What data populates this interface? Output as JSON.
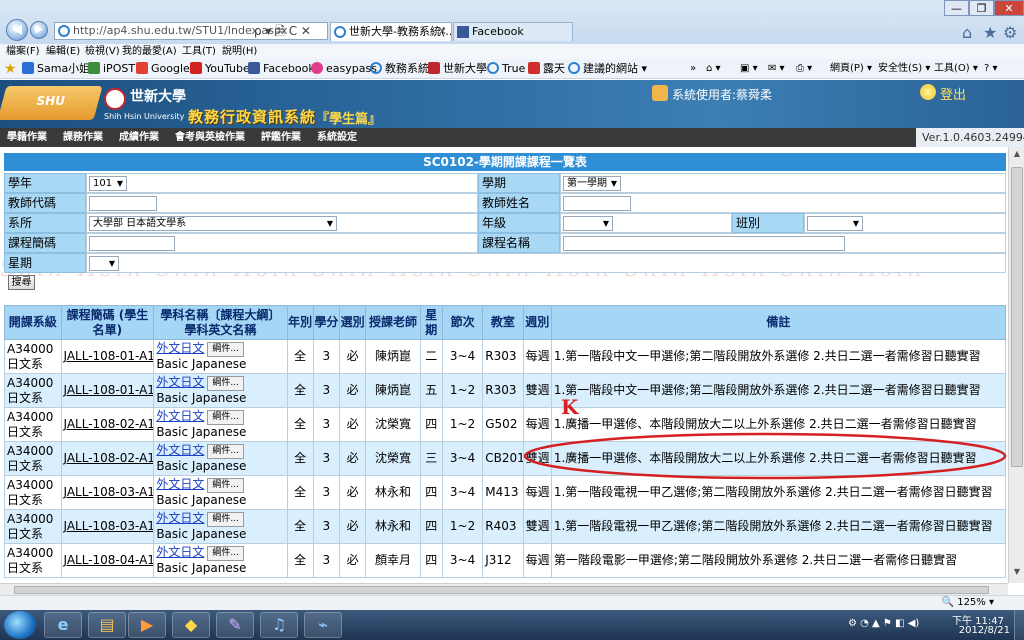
{
  "browser": {
    "url": "http://ap4.shu.edu.tw/STU1/Index.aspx",
    "address_icons": "ρ ▾ 🗎 C ✕",
    "tabs": [
      {
        "label": "世新大學-教務系統(...",
        "close": "✕"
      },
      {
        "label": "Facebook"
      }
    ],
    "window_buttons": {
      "minimize": "—",
      "maximize": "❐",
      "close": "✕"
    },
    "right_icons": {
      "home": "⌂",
      "star": "★",
      "gear": "⚙"
    },
    "menu": [
      "檔案(F)",
      "編輯(E)",
      "檢視(V)",
      "我的最愛(A)",
      "工具(T)",
      "說明(H)"
    ],
    "favorites": [
      {
        "label": "Sama小姐",
        "color": "#2c6ed5"
      },
      {
        "label": "iPOST",
        "color": "#3e8e3e"
      },
      {
        "label": "Google",
        "color": "#e34133"
      },
      {
        "label": "YouTube",
        "color": "#d32020"
      },
      {
        "label": "Facebook",
        "color": "#3b5998"
      },
      {
        "label": "easypass",
        "color": "#e03c8b"
      },
      {
        "label": "教務系統",
        "color": "#2f7fd1"
      },
      {
        "label": "世新大學",
        "color": "#c0282f"
      },
      {
        "label": "True",
        "color": "#2f7fd1"
      },
      {
        "label": "露天",
        "color": "#d12f2f"
      },
      {
        "label": "建議的網站 ▾",
        "color": "#2f7fd1"
      }
    ],
    "commands": {
      "more": "»",
      "home": "⌂ ▾",
      "rss": "▣ ▾",
      "mail": "✉ ▾",
      "print": "⎙ ▾",
      "page": "網頁(P) ▾",
      "safety": "安全性(S) ▾",
      "tools": "工具(O) ▾",
      "help": "? ▾"
    }
  },
  "site": {
    "logo_text": "SHU",
    "uni_name": "世新大學",
    "uni_en": "Shih Hsin University",
    "system_title": "教務行政資訊系統",
    "system_sub": "『學生篇』",
    "user_label": "系統使用者:蔡舜柔",
    "logout": "登出",
    "nav": [
      "學籍作業",
      "課務作業",
      "成績作業",
      "會考與英檢作業",
      "評鑑作業",
      "系統設定"
    ],
    "version": "Ver.1.0.4603.24994",
    "watermark": "Shih Hsin   Shih Hsin   Shih Hsin   Shih Hsin   Shih Hsin   Shih Hsin"
  },
  "query": {
    "title": "SC0102-學期開課課程一覽表",
    "year_label": "學年",
    "year_value": "101",
    "term_label": "學期",
    "term_value": "第一學期",
    "teacher_code_label": "教師代碼",
    "teacher_code_value": "",
    "teacher_name_label": "教師姓名",
    "teacher_name_value": "",
    "dept_label": "系所",
    "dept_value": "大學部 日本語文學系",
    "grade_label": "年級",
    "grade_value": "",
    "class_label": "班別",
    "class_value": "",
    "course_code_label": "課程簡碼",
    "course_code_value": "",
    "course_name_label": "課程名稱",
    "course_name_value": "",
    "weekday_label": "星期",
    "weekday_value": "",
    "search_button": "搜尋"
  },
  "table": {
    "headers": {
      "dept": "開課系級",
      "code": "課程簡碼 (學生名單)",
      "name": "學科名稱〔課程大綱〕 學科英文名稱",
      "year": "年別",
      "credit": "學分",
      "req": "選別",
      "teacher": "授課老師",
      "day": "星期",
      "period": "節次",
      "room": "教室",
      "week": "週別",
      "note": "備註"
    },
    "rows": [
      {
        "dept": "A34000",
        "dept2": "日文系",
        "code": "JALL-108-01-A1",
        "name": "外文日文",
        "syl": "綱件...",
        "en": "Basic Japanese",
        "year": "全",
        "credit": "3",
        "req": "必",
        "teacher": "陳炳崑",
        "day": "二",
        "period": "3~4",
        "room": "R303",
        "week": "每週",
        "note": "1.第一階段中文一甲選修;第二階段開放外系選修 2.共日二選一者需修習日聽實習"
      },
      {
        "dept": "A34000",
        "dept2": "日文系",
        "code": "JALL-108-01-A1",
        "name": "外文日文",
        "syl": "綱件...",
        "en": "Basic Japanese",
        "year": "全",
        "credit": "3",
        "req": "必",
        "teacher": "陳炳崑",
        "day": "五",
        "period": "1~2",
        "room": "R303",
        "week": "雙週",
        "note": "1.第一階段中文一甲選修;第二階段開放外系選修 2.共日二選一者需修習日聽實習"
      },
      {
        "dept": "A34000",
        "dept2": "日文系",
        "code": "JALL-108-02-A1",
        "name": "外文日文",
        "syl": "綱件...",
        "en": "Basic Japanese",
        "year": "全",
        "credit": "3",
        "req": "必",
        "teacher": "沈榮寬",
        "day": "四",
        "period": "1~2",
        "room": "G502",
        "week": "每週",
        "note": "1.廣播一甲選修、本階段開放大二以上外系選修 2.共日二選一者需修習日聽實習"
      },
      {
        "dept": "A34000",
        "dept2": "日文系",
        "code": "JALL-108-02-A1",
        "name": "外文日文",
        "syl": "綱件...",
        "en": "Basic Japanese",
        "year": "全",
        "credit": "3",
        "req": "必",
        "teacher": "沈榮寬",
        "day": "三",
        "period": "3~4",
        "room": "CB201",
        "week": "雙週",
        "note": "1.廣播一甲選修、本階段開放大二以上外系選修 2.共日二選一者需修習日聽實習"
      },
      {
        "dept": "A34000",
        "dept2": "日文系",
        "code": "JALL-108-03-A1",
        "name": "外文日文",
        "syl": "綱件...",
        "en": "Basic Japanese",
        "year": "全",
        "credit": "3",
        "req": "必",
        "teacher": "林永和",
        "day": "四",
        "period": "3~4",
        "room": "M413",
        "week": "每週",
        "note": "1.第一階段電視一甲乙選修;第二階段開放外系選修 2.共日二選一者需修習日聽實習"
      },
      {
        "dept": "A34000",
        "dept2": "日文系",
        "code": "JALL-108-03-A1",
        "name": "外文日文",
        "syl": "綱件...",
        "en": "Basic Japanese",
        "year": "全",
        "credit": "3",
        "req": "必",
        "teacher": "林永和",
        "day": "四",
        "period": "1~2",
        "room": "R403",
        "week": "雙週",
        "note": "1.第一階段電視一甲乙選修;第二階段開放外系選修 2.共日二選一者需修習日聽實習"
      },
      {
        "dept": "A34000",
        "dept2": "日文系",
        "code": "JALL-108-04-A1",
        "name": "外文日文",
        "syl": "綱件...",
        "en": "Basic Japanese",
        "year": "全",
        "credit": "3",
        "req": "必",
        "teacher": "顏幸月",
        "day": "四",
        "period": "3~4",
        "room": "J312",
        "week": "每週",
        "note": "第一階段電影一甲選修;第二階段開放外系選修 2.共日二選一者需修日聽實習"
      }
    ],
    "annotation_mark": "K"
  },
  "statusbar": {
    "zoom": "🔍 125% ▾"
  },
  "taskbar": {
    "apps": [
      {
        "icon": "e",
        "color": "#1f8ad6"
      },
      {
        "icon": "▤",
        "color": "#e6b14a"
      },
      {
        "icon": "▶",
        "color": "#e36b1c"
      },
      {
        "icon": "◆",
        "color": "#f0c020"
      },
      {
        "icon": "✎",
        "color": "#9a6fd0"
      },
      {
        "icon": "♫",
        "color": "#3a8fe0"
      },
      {
        "icon": "⌁",
        "color": "#2c6ed5"
      }
    ],
    "tray_icons": "⚙ ◔ ▲ ⚑ ◧ ◀)",
    "time": "下午 11:47",
    "date": "2012/8/21"
  }
}
